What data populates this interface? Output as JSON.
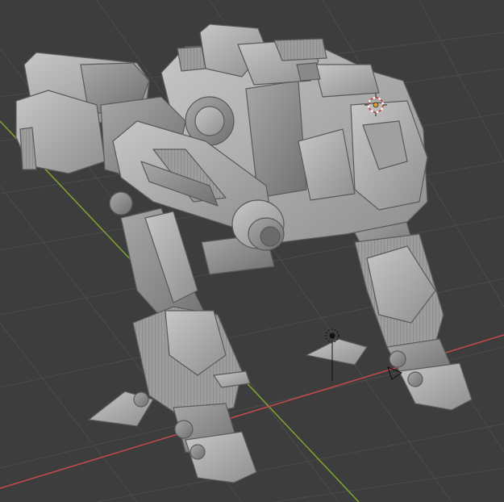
{
  "app": {
    "name": "3D viewport",
    "background_color": "#3d3d3d",
    "grid_color": "#4a4a4a",
    "x_axis_color": "#c64a4a",
    "y_axis_color": "#7fa52e"
  },
  "scene": {
    "object": "mech-model",
    "model_color": "#a9a9a9",
    "gizmos": [
      "3d-cursor-icon",
      "origin-marker-icon",
      "light-gizmo-icon",
      "camera-gizmo-icon"
    ]
  }
}
